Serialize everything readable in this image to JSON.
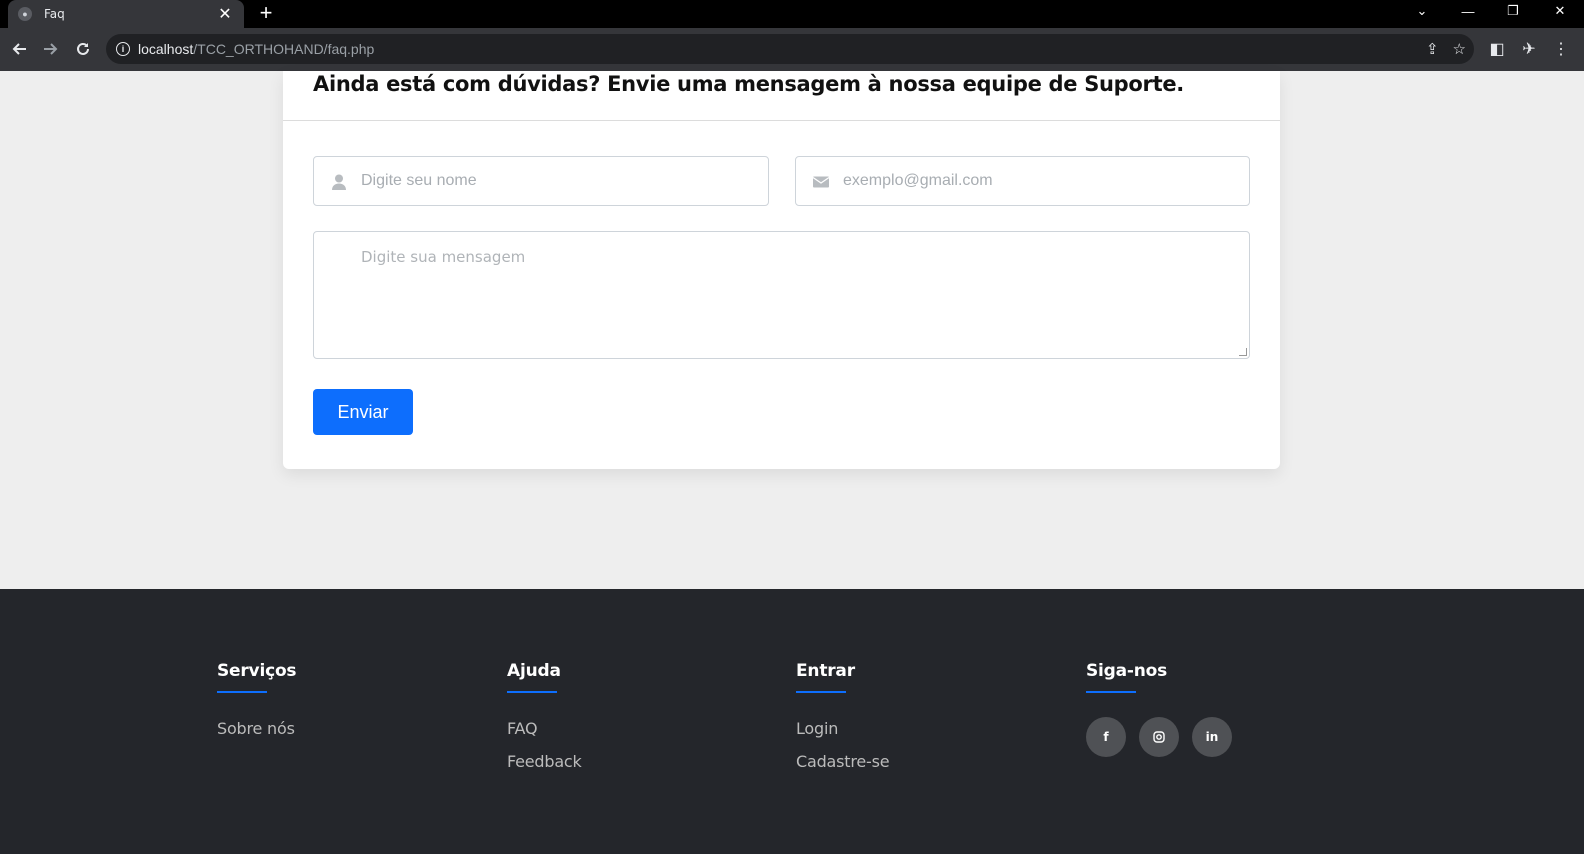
{
  "browser": {
    "tab_title": "Faq",
    "url_host": "localhost",
    "url_path": "/TCC_ORTHOHAND/faq.php"
  },
  "contact": {
    "title": "Ainda está com dúvidas? Envie uma mensagem à nossa equipe de Suporte.",
    "name_placeholder": "Digite seu nome",
    "email_placeholder": "exemplo@gmail.com",
    "message_placeholder": "Digite sua mensagem",
    "send_label": "Enviar",
    "accent_color": "#0d6efd"
  },
  "footer": {
    "columns": [
      {
        "title": "Serviços",
        "links": [
          "Sobre nós"
        ]
      },
      {
        "title": "Ajuda",
        "links": [
          "FAQ",
          "Feedback"
        ]
      },
      {
        "title": "Entrar",
        "links": [
          "Login",
          "Cadastre-se"
        ]
      },
      {
        "title": "Siga-nos",
        "social": [
          "facebook-icon",
          "instagram-icon",
          "linkedin-icon"
        ]
      }
    ]
  }
}
